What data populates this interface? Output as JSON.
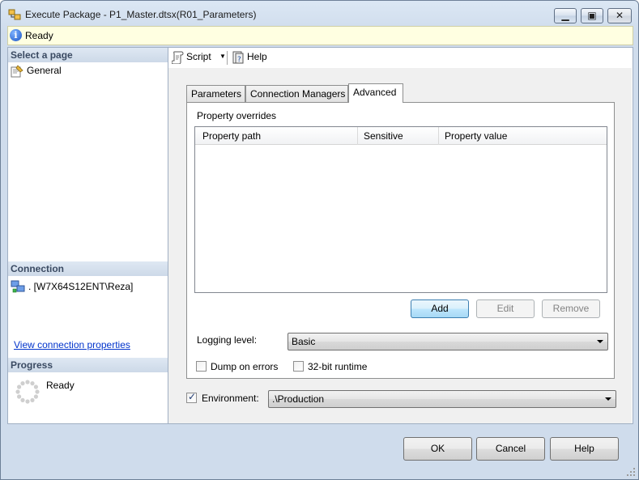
{
  "window": {
    "title": "Execute Package - P1_Master.dtsx(R01_Parameters)"
  },
  "status": {
    "text": "Ready"
  },
  "left": {
    "select_header": "Select a page",
    "pages": [
      {
        "label": "General"
      }
    ],
    "connection_header": "Connection",
    "connection_value": ". [W7X64S12ENT\\Reza]",
    "connection_link": "View connection properties",
    "progress_header": "Progress",
    "progress_text": "Ready"
  },
  "toolbar": {
    "script_label": "Script",
    "help_label": "Help"
  },
  "tabs": [
    {
      "label": "Parameters",
      "active": false
    },
    {
      "label": "Connection Managers",
      "active": false
    },
    {
      "label": "Advanced",
      "active": true
    }
  ],
  "advanced": {
    "overrides_label": "Property overrides",
    "columns": [
      "Property path",
      "Sensitive",
      "Property value"
    ],
    "rows": [],
    "add_label": "Add",
    "edit_label": "Edit",
    "remove_label": "Remove",
    "logging_label": "Logging level:",
    "logging_value": "Basic",
    "dump_label": "Dump on errors",
    "dump_checked": false,
    "runtime_label": "32-bit runtime",
    "runtime_checked": false
  },
  "environment": {
    "label": "Environment:",
    "checked": true,
    "value": ".\\Production"
  },
  "buttons": {
    "ok": "OK",
    "cancel": "Cancel",
    "help": "Help"
  }
}
